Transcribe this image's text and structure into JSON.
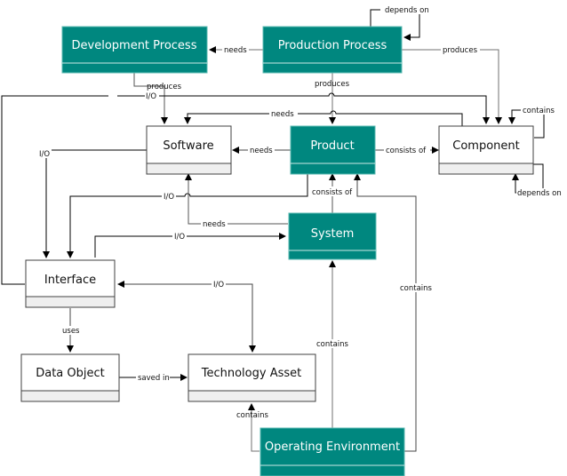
{
  "colors": {
    "teal": "#00877f",
    "teal_border": "#5ab8b0",
    "white_box_fill": "#ffffff",
    "white_box_footer": "#efefef",
    "border": "#404040",
    "line": "#000000",
    "line_gray": "#707070"
  },
  "entities": [
    {
      "id": "development-process",
      "label": "Development Process",
      "style": "teal"
    },
    {
      "id": "production-process",
      "label": "Production Process",
      "style": "teal"
    },
    {
      "id": "software",
      "label": "Software",
      "style": "white"
    },
    {
      "id": "product",
      "label": "Product",
      "style": "teal"
    },
    {
      "id": "component",
      "label": "Component",
      "style": "white"
    },
    {
      "id": "system",
      "label": "System",
      "style": "teal"
    },
    {
      "id": "interface",
      "label": "Interface",
      "style": "white"
    },
    {
      "id": "data-object",
      "label": "Data Object",
      "style": "white"
    },
    {
      "id": "technology-asset",
      "label": "Technology Asset",
      "style": "white"
    },
    {
      "id": "operating-environment",
      "label": "Operating Environment",
      "style": "teal"
    }
  ],
  "relations": [
    {
      "from": "production-process",
      "to": "production-process",
      "label": "depends on"
    },
    {
      "from": "production-process",
      "to": "development-process",
      "label": "needs"
    },
    {
      "from": "production-process",
      "to": "component",
      "label": "produces"
    },
    {
      "from": "production-process",
      "to": "product",
      "label": "produces"
    },
    {
      "from": "development-process",
      "to": "software",
      "label": "produces"
    },
    {
      "from": "interface",
      "to": "component",
      "label": "I/O"
    },
    {
      "from": "component",
      "to": "software",
      "label": "needs"
    },
    {
      "from": "component",
      "to": "component",
      "label": "contains"
    },
    {
      "from": "component",
      "to": "component",
      "label": "depends on"
    },
    {
      "from": "product",
      "to": "software",
      "label": "needs"
    },
    {
      "from": "product",
      "to": "component",
      "label": "consists of"
    },
    {
      "from": "software",
      "to": "interface",
      "label": "I/O"
    },
    {
      "from": "product",
      "to": "interface",
      "label": "I/O"
    },
    {
      "from": "system",
      "to": "product",
      "label": "consists of"
    },
    {
      "from": "system",
      "to": "software",
      "label": "needs"
    },
    {
      "from": "interface",
      "to": "system",
      "label": "I/O"
    },
    {
      "from": "interface",
      "to": "technology-asset",
      "label": "I/O"
    },
    {
      "from": "interface",
      "to": "data-object",
      "label": "uses"
    },
    {
      "from": "data-object",
      "to": "technology-asset",
      "label": "saved in"
    },
    {
      "from": "operating-environment",
      "to": "technology-asset",
      "label": "contains"
    },
    {
      "from": "operating-environment",
      "to": "system",
      "label": "contains"
    },
    {
      "from": "operating-environment",
      "to": "product",
      "label": "contains"
    }
  ]
}
